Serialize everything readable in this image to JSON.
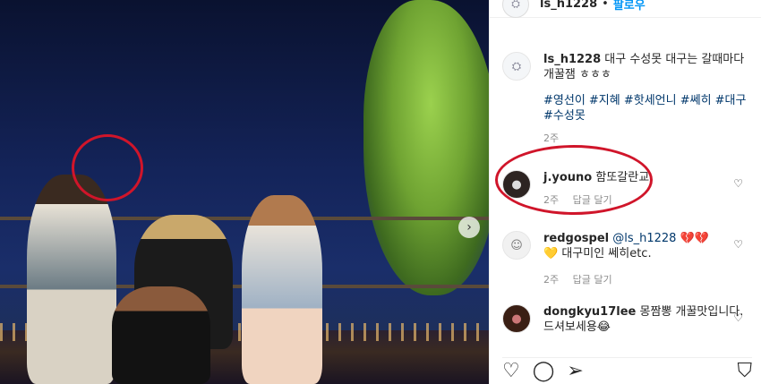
{
  "post": {
    "author": "ls_h1228",
    "follow_label": "팔로우",
    "separator": "•",
    "caption": "대구 수성못 대구는 갈때마다 개꿀잼 ㅎㅎㅎ",
    "hashtags": "#영선이 #지혜 #핫세언니 #쎄히 #대구 #수성못",
    "time": "2주"
  },
  "comments": [
    {
      "user": "j.youno",
      "text": "함또갈란교",
      "time": "2주",
      "reply": "답글 달기"
    },
    {
      "user": "redgospel",
      "mention": "@ls_h1228",
      "emoji": "💔💔",
      "text": "💛 대구미인 쎄히etc.",
      "time": "2주",
      "reply": "답글 달기"
    },
    {
      "user": "dongkyu17lee",
      "text": "몽짬뽕 개꿀맛입니다. 드셔보세용😂",
      "time": "",
      "reply": ""
    }
  ],
  "icons": [
    "heart-icon",
    "comment-icon",
    "share-icon",
    "bookmark-icon",
    "chevron-right-icon"
  ],
  "colors": {
    "accent": "#0095f6",
    "highlight": "#d0152a",
    "hashtag": "#00376b"
  }
}
